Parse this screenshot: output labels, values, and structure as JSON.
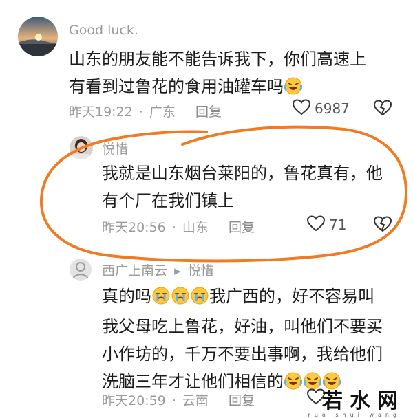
{
  "comments": [
    {
      "username": "Good luck.",
      "line1": "山东的朋友能不能告诉我下，你们高速上",
      "line2": "有看到过鲁花的食用油罐车吗",
      "time": "昨天19:22",
      "location": "广东",
      "reply_label": "回复",
      "likes": "6987"
    },
    {
      "username": "悦惜",
      "line1": "我就是山东烟台莱阳的，鲁花真有，他",
      "line2": "有个厂在我们镇上",
      "time": "昨天20:56",
      "location": "山东",
      "reply_label": "回复",
      "likes": "71"
    },
    {
      "username": "西广上南云",
      "reply_to": "悦惜",
      "line1": "真的吗",
      "line1b": "我广西的，好不容易叫",
      "line2": "我父母吃上鲁花，好油，叫他们不要买",
      "line3": "小作坊的，千万不要出事啊，我给他们",
      "line4": "洗脑三年才让他们相信的",
      "time": "昨天20:59",
      "location": "云南",
      "reply_label": "回复"
    }
  ],
  "separator": "·",
  "reply_arrow": "▸",
  "watermark": "若水网",
  "watermark_sub": "ruo shui wang",
  "colors": {
    "annotation": "#f07b22",
    "meta": "#9c9c9c",
    "username": "#9a9a9a"
  },
  "icons": [
    "heart-icon",
    "dislike-heart-icon",
    "laughing-emoji-icon",
    "crying-emoji-icon"
  ]
}
